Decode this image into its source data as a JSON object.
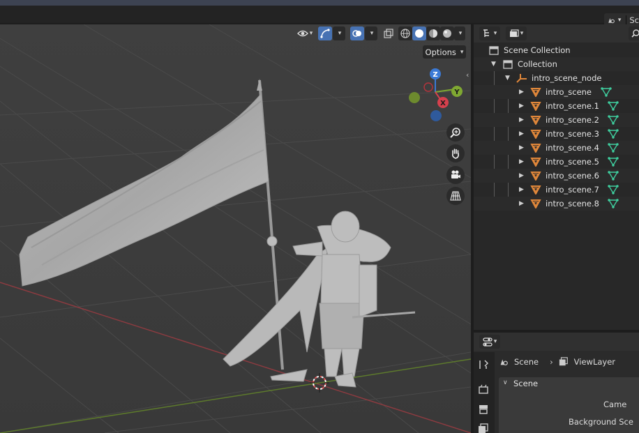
{
  "topbar": {
    "scene_label": "Sc"
  },
  "viewport": {
    "options_label": "Options",
    "gizmo": {
      "z": "Z",
      "y": "Y",
      "x": "X"
    }
  },
  "outliner": {
    "rows": [
      {
        "label": "Scene Collection",
        "icon": "scene-collection-icon"
      },
      {
        "label": "Collection",
        "icon": "collection-icon"
      },
      {
        "label": "intro_scene_node",
        "icon": "empty-object-icon"
      },
      {
        "label": "intro_scene",
        "icon": "mesh-object-icon"
      },
      {
        "label": "intro_scene.1",
        "icon": "mesh-object-icon"
      },
      {
        "label": "intro_scene.2",
        "icon": "mesh-object-icon"
      },
      {
        "label": "intro_scene.3",
        "icon": "mesh-object-icon"
      },
      {
        "label": "intro_scene.4",
        "icon": "mesh-object-icon"
      },
      {
        "label": "intro_scene.5",
        "icon": "mesh-object-icon"
      },
      {
        "label": "intro_scene.6",
        "icon": "mesh-object-icon"
      },
      {
        "label": "intro_scene.7",
        "icon": "mesh-object-icon"
      },
      {
        "label": "intro_scene.8",
        "icon": "mesh-object-icon"
      }
    ]
  },
  "properties": {
    "breadcrumb_scene": "Scene",
    "breadcrumb_viewlayer": "ViewLayer",
    "panel_title": "Scene",
    "field_camera": "Came",
    "field_background": "Background Sce"
  },
  "colors": {
    "selection_blue": "#4772b3",
    "object_orange": "#e0873a",
    "mesh_green": "#3fcf9f",
    "axis_red": "#b3343d",
    "axis_green": "#7fa832",
    "axis_blue": "#3b7ad6"
  }
}
